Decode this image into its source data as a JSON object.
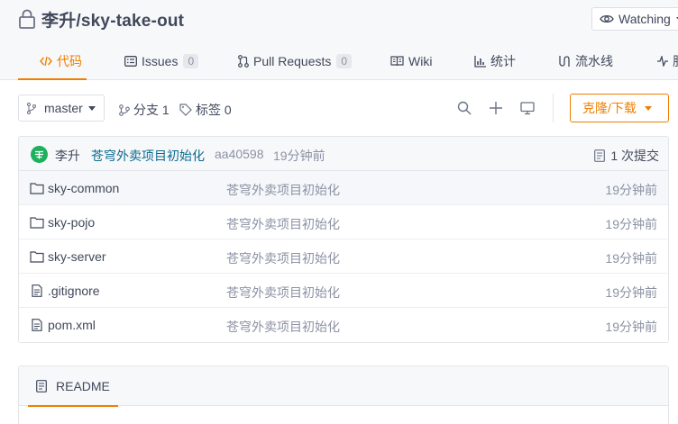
{
  "repo": {
    "owner": "李升",
    "slash": "/",
    "name": "sky-take-out"
  },
  "watch": {
    "label": "Watching"
  },
  "tabs": [
    {
      "label": "代码",
      "active": true
    },
    {
      "label": "Issues",
      "count": "0"
    },
    {
      "label": "Pull Requests",
      "count": "0"
    },
    {
      "label": "Wiki"
    },
    {
      "label": "统计"
    },
    {
      "label": "流水线"
    },
    {
      "label": "服"
    }
  ],
  "toolbar": {
    "branch": "master",
    "branches_label": "分支 1",
    "tags_label": "标签 0",
    "clone_label": "克隆/下载"
  },
  "last_commit": {
    "author": "李升",
    "message": "苍穹外卖项目初始化",
    "hash": "aa40598",
    "time": "19分钟前",
    "commit_count": "1 次提交"
  },
  "files": [
    {
      "name": "sky-common",
      "type": "folder",
      "commit": "苍穹外卖项目初始化",
      "time": "19分钟前"
    },
    {
      "name": "sky-pojo",
      "type": "folder",
      "commit": "苍穹外卖项目初始化",
      "time": "19分钟前"
    },
    {
      "name": "sky-server",
      "type": "folder",
      "commit": "苍穹外卖项目初始化",
      "time": "19分钟前"
    },
    {
      "name": ".gitignore",
      "type": "file",
      "commit": "苍穹外卖项目初始化",
      "time": "19分钟前"
    },
    {
      "name": "pom.xml",
      "type": "file",
      "commit": "苍穹外卖项目初始化",
      "time": "19分钟前"
    }
  ],
  "readme": {
    "label": "README"
  },
  "colors": {
    "accent": "#f07f00",
    "link": "#0b6a8f",
    "muted": "#8c92a4",
    "avatar": "#1fb05e"
  },
  "icons": [
    "lock-icon",
    "eye-icon",
    "code-icon",
    "issues-icon",
    "pull-request-icon",
    "wiki-icon",
    "stats-icon",
    "pipeline-icon",
    "branch-icon",
    "tag-icon",
    "search-icon",
    "plus-icon",
    "monitor-icon",
    "commits-icon",
    "folder-icon",
    "file-icon",
    "readme-icon"
  ]
}
